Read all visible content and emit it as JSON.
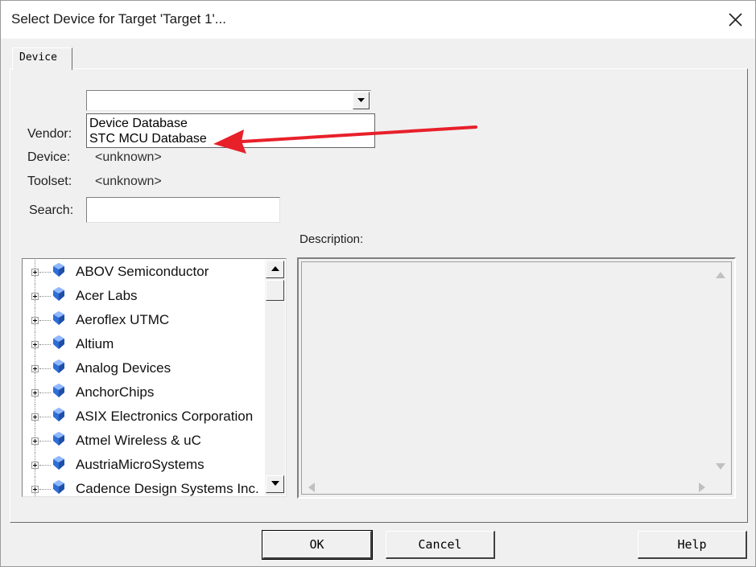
{
  "window": {
    "title": "Select Device for Target 'Target 1'..."
  },
  "tabs": [
    {
      "label": "Device"
    }
  ],
  "form": {
    "vendor_label": "Vendor:",
    "device_label": "Device:",
    "device_value": "<unknown>",
    "toolset_label": "Toolset:",
    "toolset_value": "<unknown>",
    "search_label": "Search:",
    "search_value": "",
    "database_value": ""
  },
  "database_dropdown": {
    "options": [
      "Device Database",
      "STC MCU Database"
    ]
  },
  "description_label": "Description:",
  "vendors": [
    "ABOV Semiconductor",
    "Acer Labs",
    "Aeroflex UTMC",
    "Altium",
    "Analog Devices",
    "AnchorChips",
    "ASIX Electronics Corporation",
    "Atmel Wireless & uC",
    "AustriaMicroSystems",
    "Cadence Design Systems Inc."
  ],
  "buttons": {
    "ok": "OK",
    "cancel": "Cancel",
    "help": "Help"
  },
  "colors": {
    "annotation_arrow": "#e8202a",
    "device_icon": "#2f6fd6"
  },
  "icons": {
    "close": "close-icon",
    "dropdown": "chevron-down-icon",
    "device": "device-gem-icon"
  }
}
